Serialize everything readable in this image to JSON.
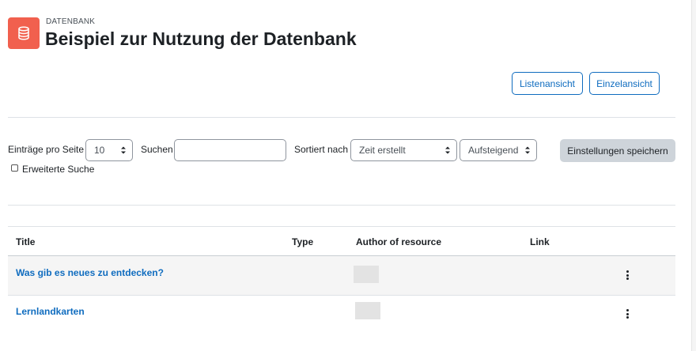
{
  "header": {
    "pretitle": "DATENBANK",
    "title": "Beispiel zur Nutzung der Datenbank",
    "icon": "database-icon",
    "icon_color": "#f1604e"
  },
  "view_buttons": {
    "list_view": "Listenansicht",
    "single_view": "Einzelansicht"
  },
  "filters": {
    "per_page_label": "Einträge pro Seite",
    "per_page_value": "10",
    "search_label": "Suchen",
    "search_value": "",
    "sort_label": "Sortiert nach",
    "sort_field_value": "Zeit erstellt",
    "sort_order_value": "Aufsteigend",
    "save_button": "Einstellungen speichern",
    "advanced_search_label": "Erweiterte Suche",
    "advanced_search_checked": false
  },
  "table": {
    "columns": [
      "Title",
      "Type",
      "Author of resource",
      "Link"
    ],
    "rows": [
      {
        "title": "Was gib es neues zu entdecken?",
        "type": "",
        "link": ""
      },
      {
        "title": "Lernlandkarten",
        "type": "",
        "link": ""
      }
    ]
  },
  "colors": {
    "accent": "#0f6cbf",
    "button_secondary": "#ced4da",
    "row_highlight": "#f5f5f5"
  }
}
